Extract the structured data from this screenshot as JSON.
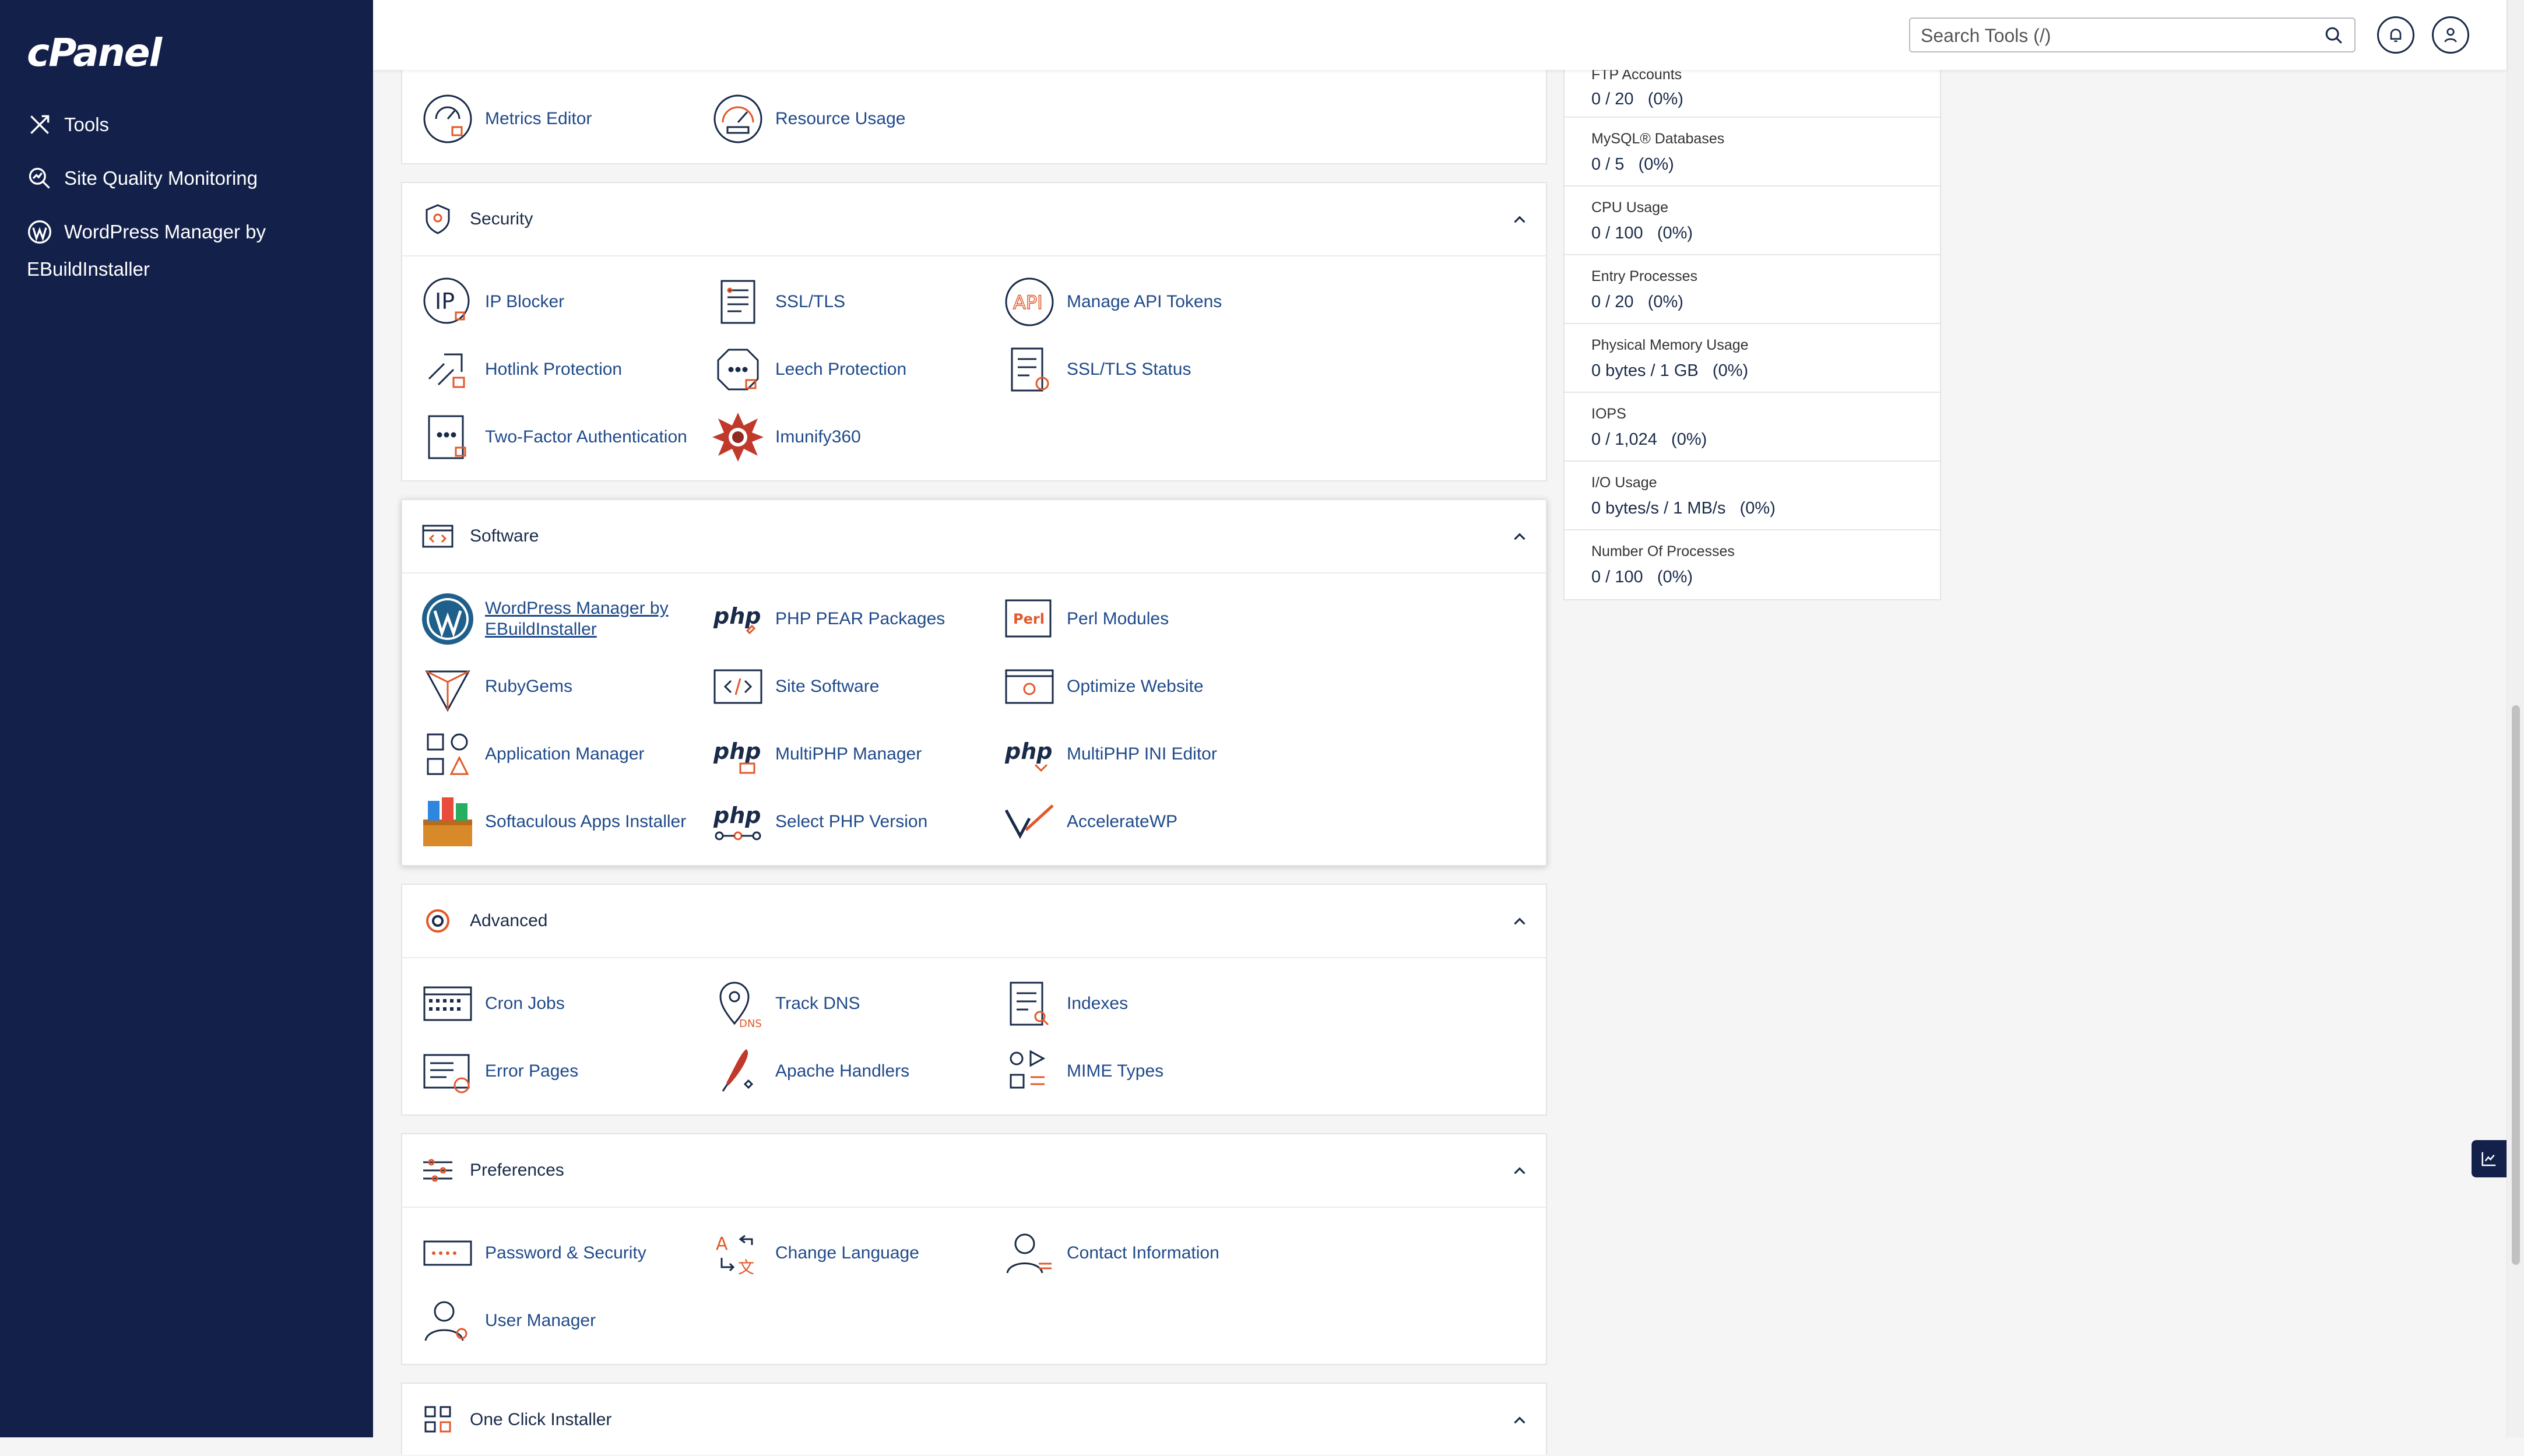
{
  "sidebar": {
    "logo": "cPanel",
    "items": [
      {
        "label": "Tools",
        "icon": "tools-icon"
      },
      {
        "label": "Site Quality Monitoring",
        "icon": "magnifier-chart-icon"
      },
      {
        "label": "WordPress Manager by EBuildInstaller",
        "icon": "wordpress-icon"
      }
    ]
  },
  "header": {
    "search_placeholder": "Search Tools (/)",
    "icons": [
      "search-icon",
      "bell-icon",
      "user-icon"
    ]
  },
  "sections": {
    "metrics_tail": {
      "tools": [
        "Metrics Editor",
        "Resource Usage"
      ]
    },
    "security": {
      "title": "Security",
      "tools": [
        "IP Blocker",
        "SSL/TLS",
        "Manage API Tokens",
        "Hotlink Protection",
        "Leech Protection",
        "SSL/TLS Status",
        "Two-Factor Authentication",
        "Imunify360"
      ]
    },
    "software": {
      "title": "Software",
      "tools": [
        "WordPress Manager by EBuildInstaller",
        "PHP PEAR Packages",
        "Perl Modules",
        "RubyGems",
        "Site Software",
        "Optimize Website",
        "Application Manager",
        "MultiPHP Manager",
        "MultiPHP INI Editor",
        "Softaculous Apps Installer",
        "Select PHP Version",
        "AccelerateWP"
      ]
    },
    "advanced": {
      "title": "Advanced",
      "tools": [
        "Cron Jobs",
        "Track DNS",
        "Indexes",
        "Error Pages",
        "Apache Handlers",
        "MIME Types"
      ]
    },
    "preferences": {
      "title": "Preferences",
      "tools": [
        "Password & Security",
        "Change Language",
        "Contact Information",
        "User Manager"
      ]
    },
    "one_click": {
      "title": "One Click Installer"
    }
  },
  "stats": [
    {
      "label": "FTP Accounts",
      "value": "0 / 20   (0%)"
    },
    {
      "label": "MySQL® Databases",
      "value": "0 / 5   (0%)"
    },
    {
      "label": "CPU Usage",
      "value": "0 / 100   (0%)"
    },
    {
      "label": "Entry Processes",
      "value": "0 / 20   (0%)"
    },
    {
      "label": "Physical Memory Usage",
      "value": "0 bytes / 1 GB   (0%)"
    },
    {
      "label": "IOPS",
      "value": "0 / 1,024   (0%)"
    },
    {
      "label": "I/O Usage",
      "value": "0 bytes/s / 1 MB/s   (0%)"
    },
    {
      "label": "Number Of Processes",
      "value": "0 / 100   (0%)"
    }
  ],
  "colors": {
    "sidebar_bg": "#13214a",
    "link": "#1f4a8a",
    "accent_orange": "#e2582a"
  }
}
